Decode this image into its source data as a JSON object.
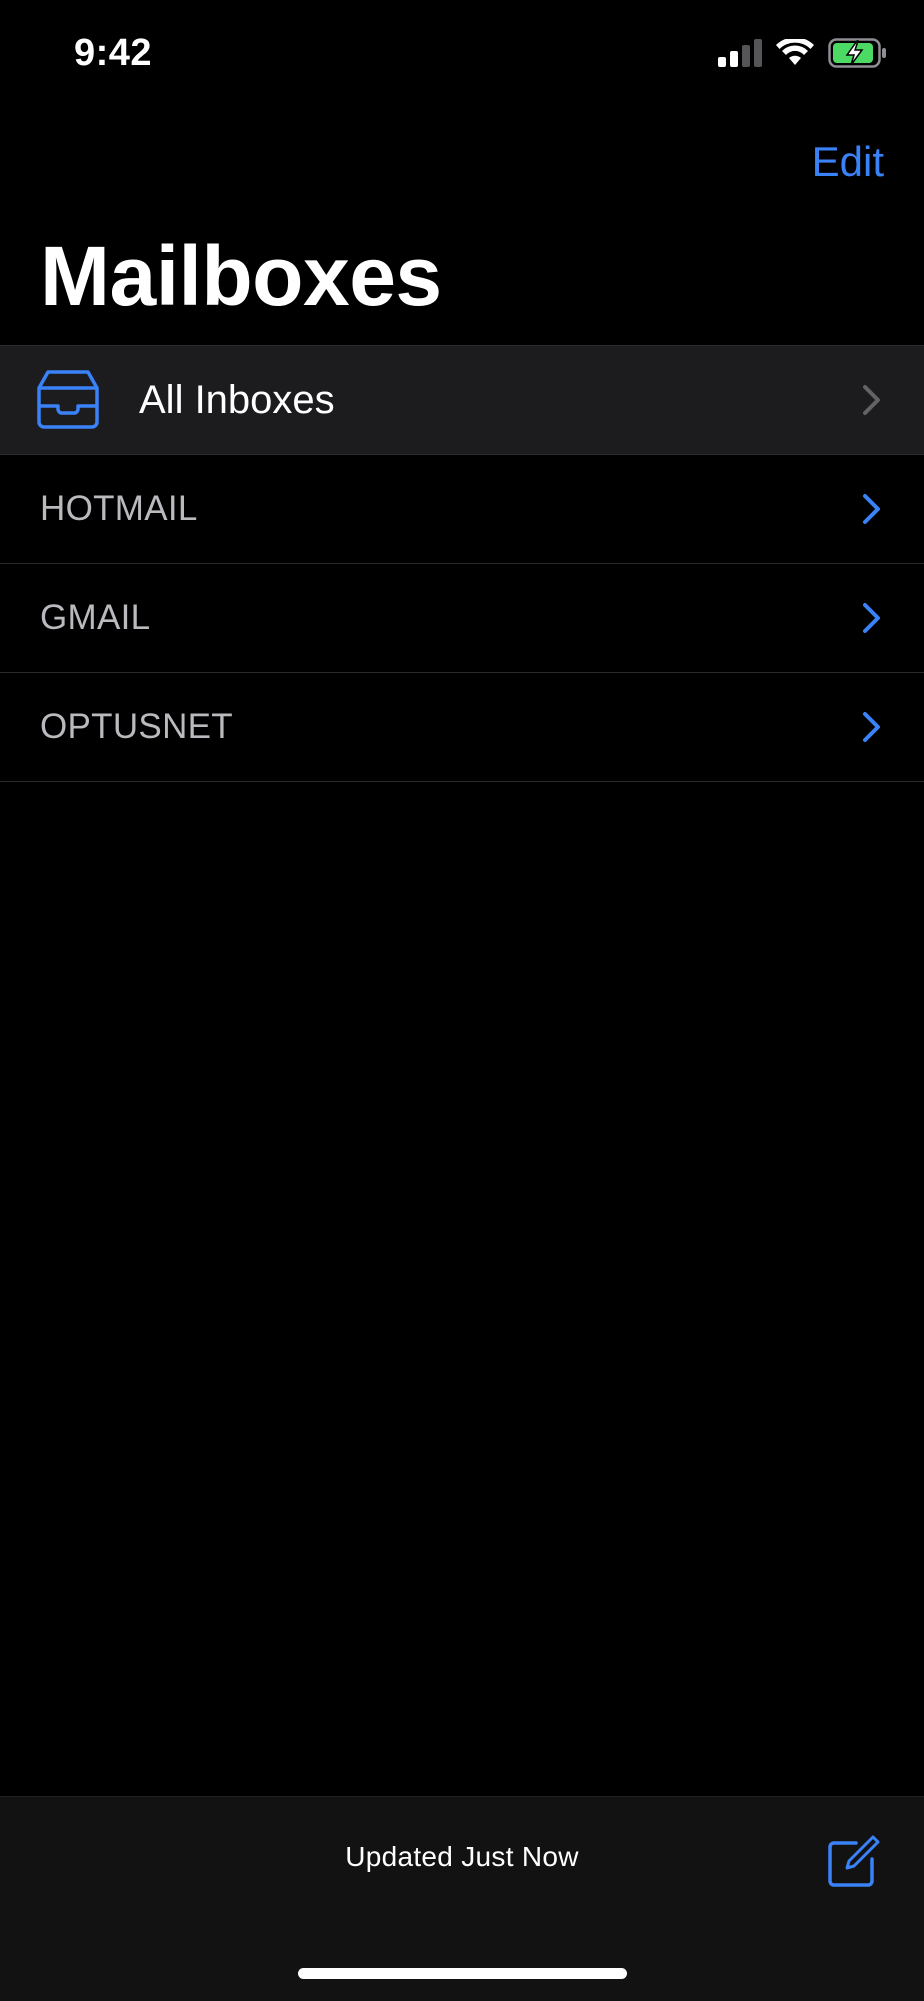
{
  "status_bar": {
    "time": "9:42"
  },
  "nav": {
    "edit_label": "Edit",
    "title": "Mailboxes"
  },
  "mailboxes": {
    "all_inboxes": {
      "label": "All Inboxes",
      "icon": "tray-icon"
    },
    "accounts": [
      {
        "label": "HOTMAIL"
      },
      {
        "label": "GMAIL"
      },
      {
        "label": "OPTUSNET"
      }
    ]
  },
  "toolbar": {
    "status_text": "Updated Just Now",
    "compose_icon": "compose-icon"
  },
  "colors": {
    "accent": "#3a82f7",
    "background": "#000000",
    "highlight_row": "#1c1c1e",
    "battery_fill": "#4cd964"
  }
}
